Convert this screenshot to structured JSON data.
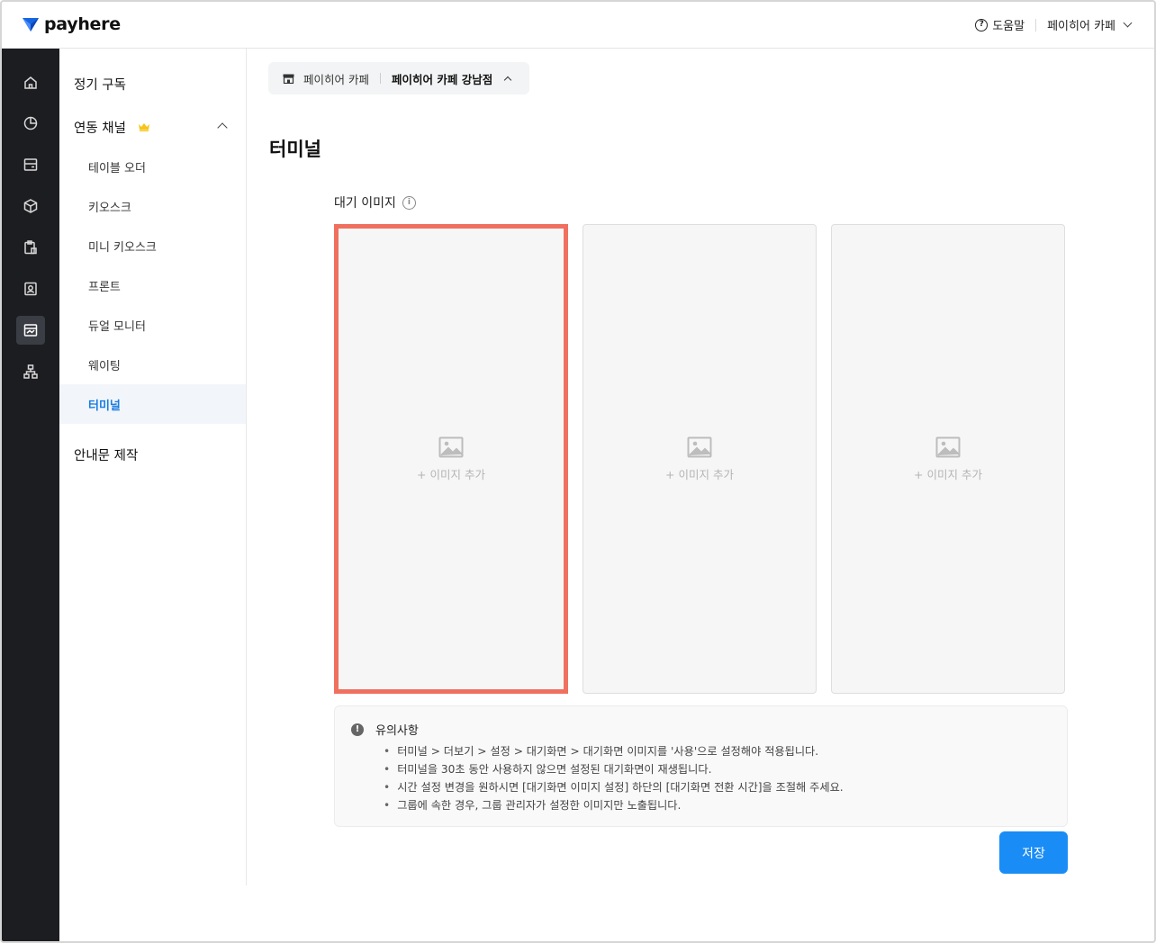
{
  "app": {
    "logo_text": "payhere"
  },
  "header": {
    "help_label": "도움말",
    "account_label": "페이히어 카페"
  },
  "rail": {
    "items": [
      {
        "icon": "home-icon"
      },
      {
        "icon": "pie-chart-icon"
      },
      {
        "icon": "card-reader-icon"
      },
      {
        "icon": "box-icon"
      },
      {
        "icon": "clipboard-icon"
      },
      {
        "icon": "contact-icon"
      },
      {
        "icon": "store-display-icon",
        "active": true
      },
      {
        "icon": "network-icon"
      }
    ]
  },
  "sidebar": {
    "subscription": "정기 구독",
    "linked_channels": "연동 채널",
    "items": [
      {
        "label": "테이블 오더"
      },
      {
        "label": "키오스크"
      },
      {
        "label": "미니 키오스크"
      },
      {
        "label": "프론트"
      },
      {
        "label": "듀얼 모니터"
      },
      {
        "label": "웨이팅"
      },
      {
        "label": "터미널",
        "active": true
      }
    ],
    "notice_making": "안내문 제작"
  },
  "store_selector": {
    "brand": "페이히어 카페",
    "store": "페이히어 카페 강남점"
  },
  "main": {
    "title": "터미널",
    "section_label": "대기 이미지",
    "slots": [
      {
        "label": "+ 이미지 추가"
      },
      {
        "label": "+ 이미지 추가"
      },
      {
        "label": "+ 이미지 추가"
      }
    ],
    "notice": {
      "title": "유의사항",
      "items": [
        "터미널 > 더보기 > 설정 > 대기화면 > 대기화면 이미지를 '사용'으로 설정해야 적용됩니다.",
        "터미널을 30초 동안 사용하지 않으면 설정된 대기화면이 재생됩니다.",
        "시간 설정 변경을 원하시면 [대기화면 이미지 설정] 하단의 [대기화면 전환 시간]을 조절해 주세요.",
        "그룹에 속한 경우, 그룹 관리자가 설정한 이미지만 노출됩니다."
      ]
    },
    "save_label": "저장"
  },
  "colors": {
    "accent": "#1a8cf5",
    "selected_border": "#f07060",
    "rail_bg": "#1c1d21",
    "active_sidebar_text": "#1a7de0"
  }
}
